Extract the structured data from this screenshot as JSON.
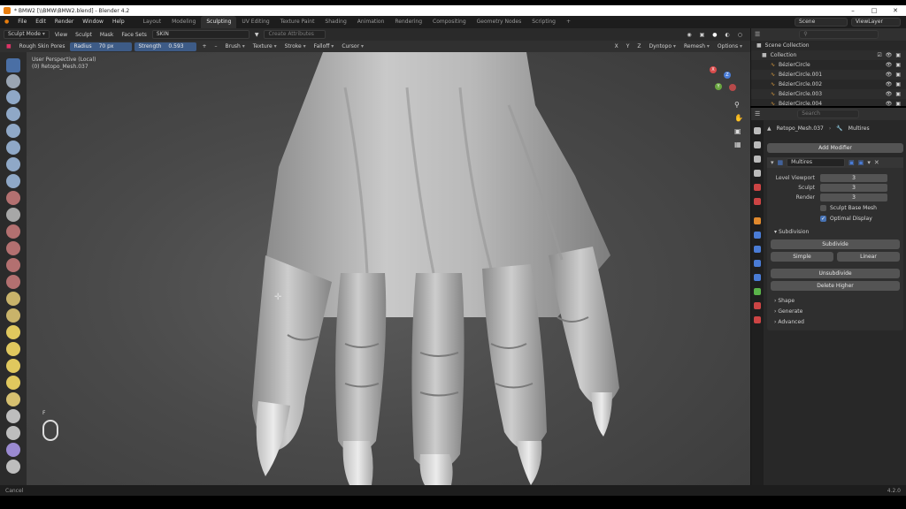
{
  "window": {
    "title": "* BMW2 [\\\\BMW\\BMW2.blend] - Blender 4.2"
  },
  "menu": [
    "File",
    "Edit",
    "Render",
    "Window",
    "Help"
  ],
  "workspaces": [
    "Layout",
    "Modeling",
    "Sculpting",
    "UV Editing",
    "Texture Paint",
    "Shading",
    "Animation",
    "Rendering",
    "Compositing",
    "Geometry Nodes",
    "Scripting"
  ],
  "active_workspace": "Sculpting",
  "topbar_right": {
    "scene": "Scene",
    "view_layer": "ViewLayer"
  },
  "header": {
    "mode": "Sculpt Mode",
    "view": "View",
    "sculpt": "Sculpt",
    "mask": "Mask",
    "face_sets": "Face Sets",
    "material": "SKIN",
    "create_attributes": "Create Attributes",
    "dyntopo": "Dyntopo",
    "remesh": "Remesh",
    "options": "Options",
    "axes": [
      "X",
      "Y",
      "Z"
    ]
  },
  "tool_settings": {
    "brush_name": "Rough Skin Pores",
    "radius_label": "Radius",
    "radius_value": "70 px",
    "strength_label": "Strength",
    "strength_value": "0.593",
    "menus": [
      "Brush",
      "Texture",
      "Stroke",
      "Falloff",
      "Cursor"
    ]
  },
  "viewport": {
    "perspective": "User Perspective (Local)",
    "object": "(0) Retopo_Mesh.037",
    "key_hint": "F"
  },
  "outliner": {
    "title": "Scene Collection",
    "collection": "Collection",
    "items": [
      "BézierCircle",
      "BézierCircle.001",
      "BézierCircle.002",
      "BézierCircle.003",
      "BézierCircle.004"
    ]
  },
  "properties": {
    "search_placeholder": "Search",
    "breadcrumb_object": "Retopo_Mesh.037",
    "breadcrumb_modifier": "Multires",
    "add_modifier": "Add Modifier",
    "modifier_name": "Multires",
    "level_viewport_label": "Level Viewport",
    "level_viewport_value": "3",
    "sculpt_label": "Sculpt",
    "sculpt_value": "3",
    "render_label": "Render",
    "render_value": "3",
    "sculpt_base_mesh": "Sculpt Base Mesh",
    "optimal_display": "Optimal Display",
    "subdivision_section": "Subdivision",
    "subdivide": "Subdivide",
    "simple": "Simple",
    "linear": "Linear",
    "unsubdivide": "Unsubdivide",
    "delete_higher": "Delete Higher",
    "sections": [
      "Shape",
      "Generate",
      "Advanced"
    ]
  },
  "status": {
    "left": "Cancel",
    "version": "4.2.0"
  },
  "colors": {
    "accent_blue": "#4772b3",
    "workspace_bg": "#303030",
    "panel_bg": "#282828"
  }
}
